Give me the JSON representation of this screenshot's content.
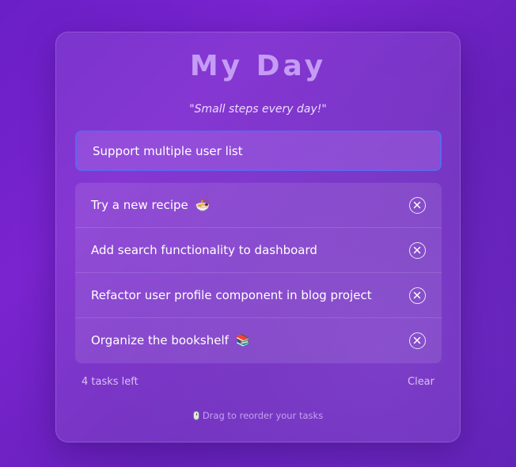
{
  "app": {
    "title": "My Day",
    "quote": "\"Small steps every day!\""
  },
  "input": {
    "value": "Support multiple user list",
    "placeholder": ""
  },
  "tasks": [
    {
      "text": "Try a new recipe",
      "emoji": "🍜"
    },
    {
      "text": "Add search functionality to dashboard",
      "emoji": ""
    },
    {
      "text": "Refactor user profile component in blog project",
      "emoji": ""
    },
    {
      "text": "Organize the bookshelf",
      "emoji": "📚"
    }
  ],
  "footer": {
    "tasks_left": "4 tasks left",
    "clear_label": "Clear"
  },
  "hint": {
    "icon": "mouse-icon",
    "text": "Drag to reorder your tasks"
  },
  "colors": {
    "title": "#c59cf5",
    "input_border": "#5b67ee",
    "background": "#6a1fc6"
  }
}
